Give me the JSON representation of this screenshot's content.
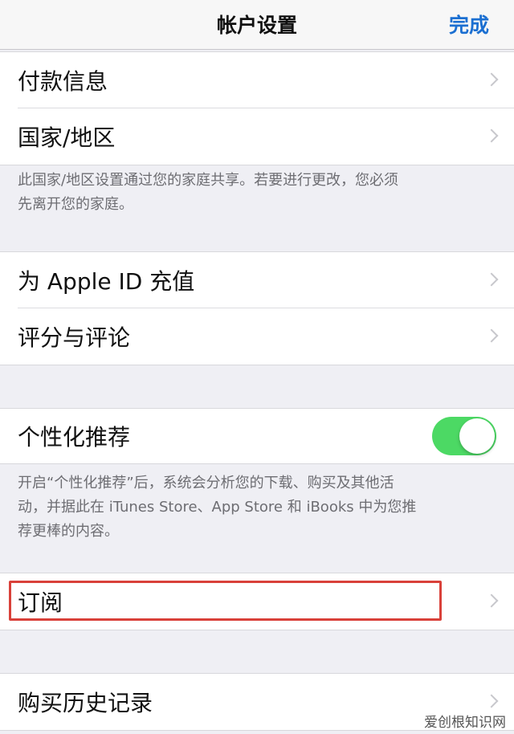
{
  "nav": {
    "title": "帐户设置",
    "done_label": "完成"
  },
  "rows": {
    "payment": "付款信息",
    "country": "国家/地区",
    "apple_id": "为 Apple ID 充值",
    "ratings": "评分与评论",
    "personalized": "个性化推荐",
    "subscriptions": "订阅",
    "purchase_history": "购买历史记录"
  },
  "notes": {
    "family_line1": "此国家/地区设置通过您的家庭共享。若要进行更改，您必须",
    "family_line2": "先离开您的家庭。",
    "personalized_line1": "开启“个性化推荐”后，系统会分析您的下载、购买及其他活",
    "personalized_line2": "动，并据此在 iTunes Store、App Store 和 iBooks 中为您推",
    "personalized_line3": "荐更棒的内容。"
  },
  "toggle": {
    "personalized_on": true,
    "on_color": "#4cd964"
  },
  "highlight_color": "#d9413a",
  "accent_color": "#1b6fd1",
  "watermark": "爱创根知识网"
}
